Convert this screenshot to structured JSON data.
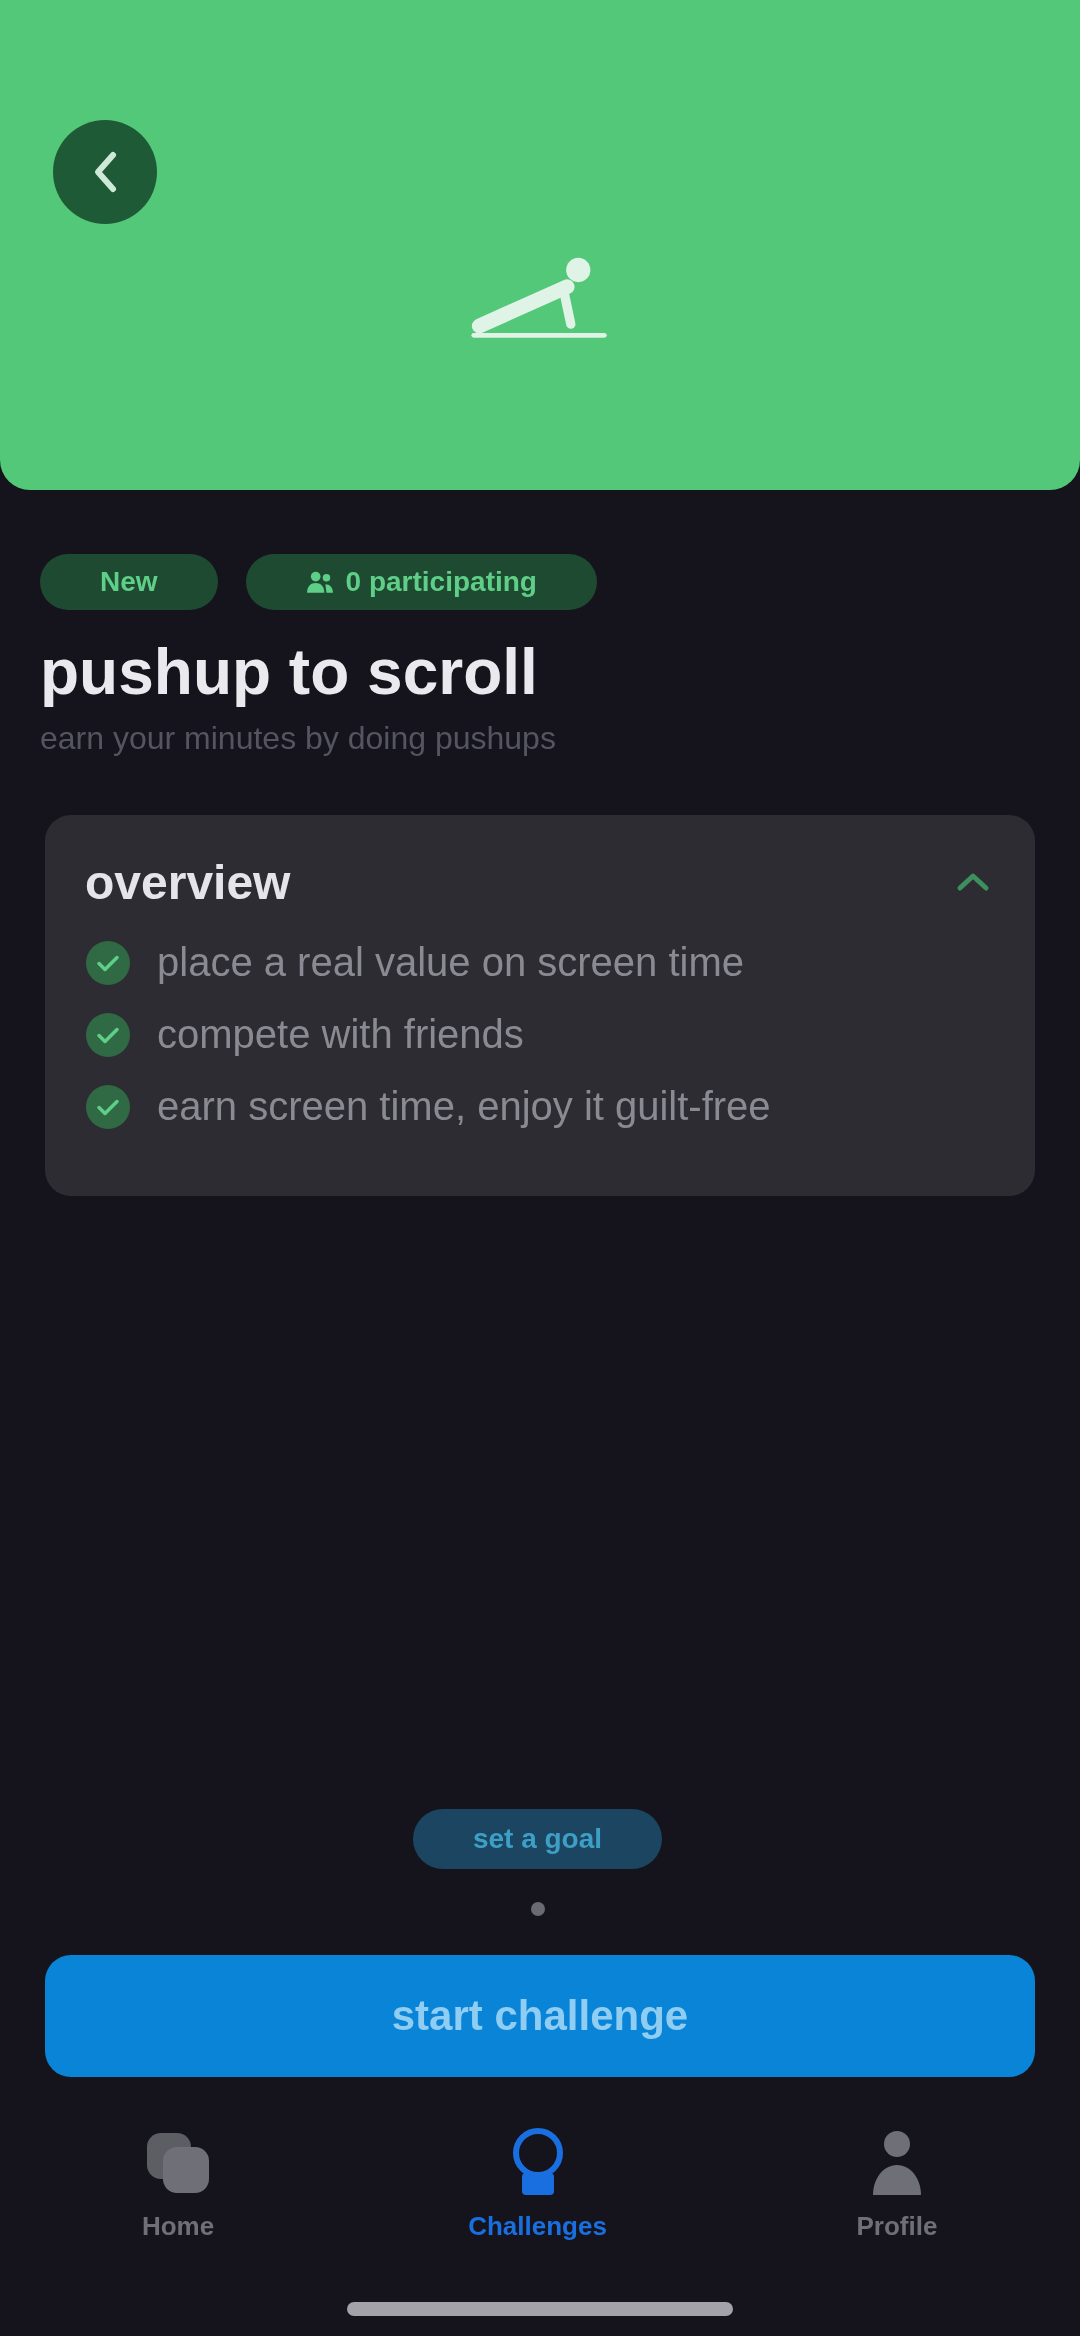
{
  "tags": [
    {
      "kind": "plain",
      "label": "New"
    },
    {
      "kind": "people",
      "label": "0 participating"
    }
  ],
  "title": "pushup to scroll",
  "subtitle": "earn your minutes by doing pushups",
  "overview": {
    "title": "overview",
    "expanded": true,
    "items": [
      {
        "text": "place a real value on screen time",
        "checked": true
      },
      {
        "text": "compete with friends",
        "checked": true
      },
      {
        "text": "earn screen time, enjoy it guilt-free",
        "checked": true
      }
    ]
  },
  "hint": "set a goal",
  "primary_button": "start challenge",
  "tab_bar": [
    {
      "label": "Home",
      "selected": false
    },
    {
      "label": "Challenges",
      "selected": true
    },
    {
      "label": "Profile",
      "selected": false
    }
  ]
}
